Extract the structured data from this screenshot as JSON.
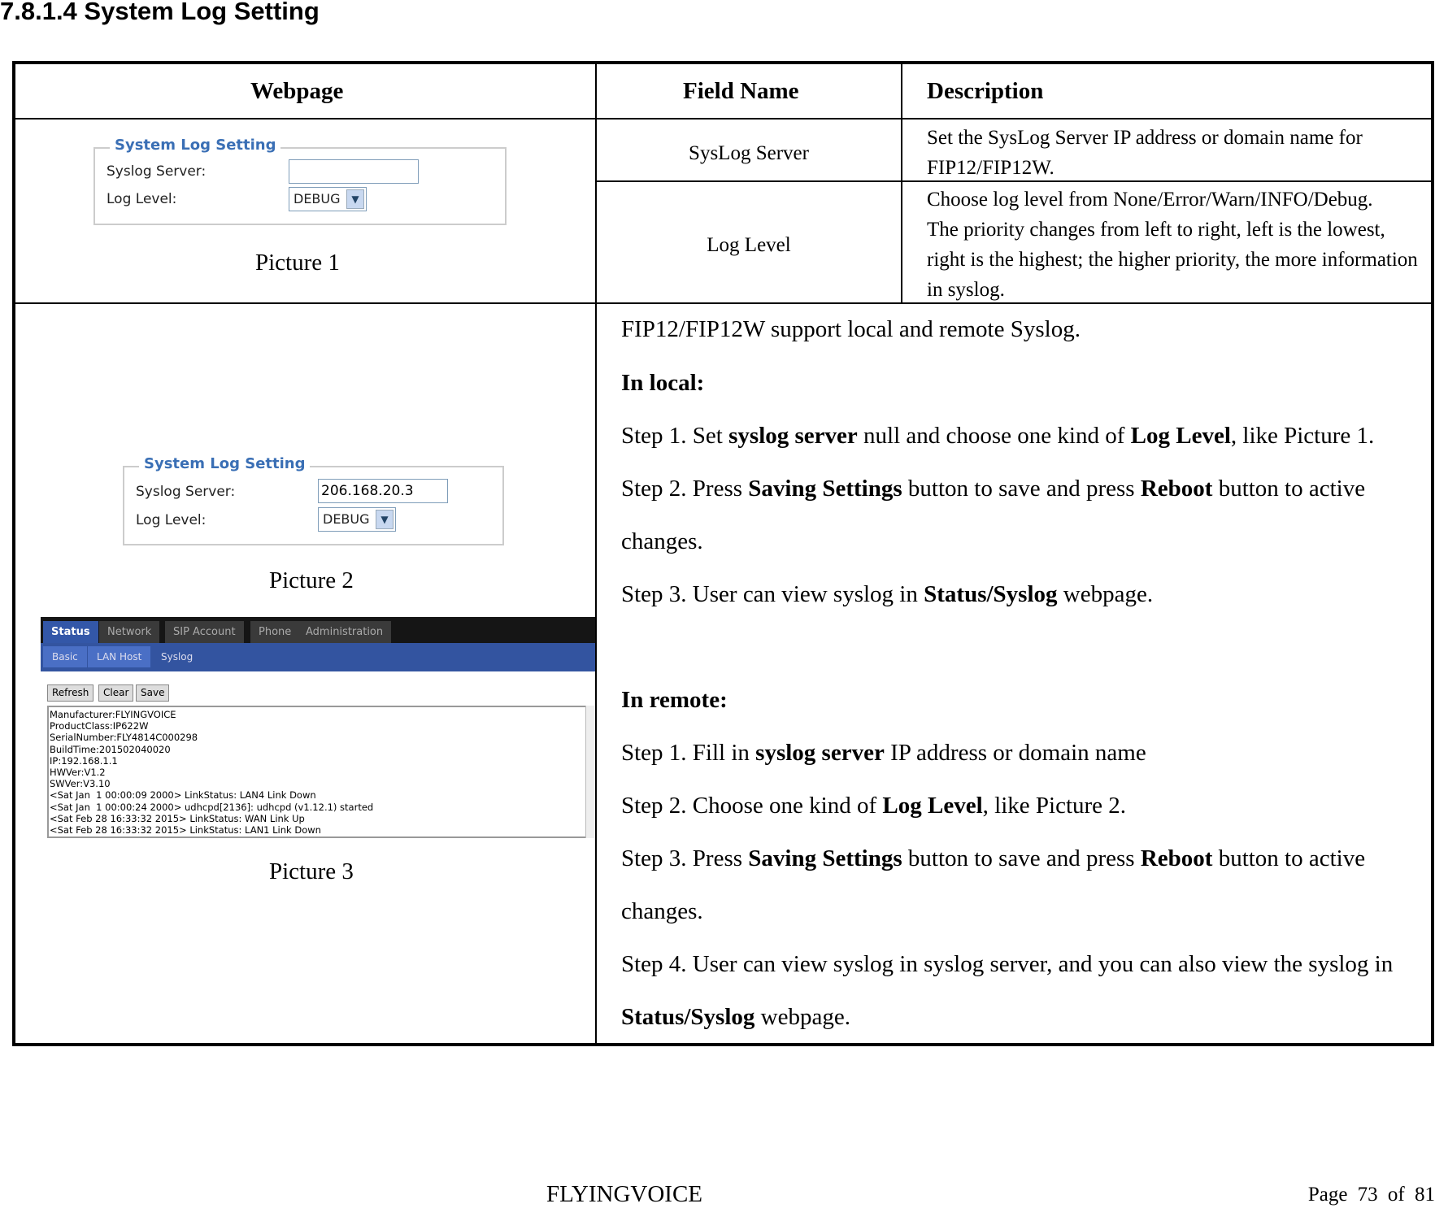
{
  "section_title": "7.8.1.4  System Log Setting",
  "table": {
    "headers": [
      "Webpage",
      "Field Name",
      "Description"
    ],
    "rows": [
      {
        "field": "SysLog Server",
        "description": [
          "Set the SysLog Server IP address or domain name for",
          "FIP12/FIP12W."
        ]
      },
      {
        "field": "Log Level",
        "description": [
          "Choose log level from None/Error/Warn/INFO/Debug.",
          "The priority changes from left to right, left is the lowest,",
          "right is the highest; the higher priority, the more information",
          "in syslog."
        ]
      }
    ]
  },
  "picture1": {
    "legend": "System Log Setting",
    "server_label": "Syslog Server:",
    "server_value": "",
    "level_label": "Log Level:",
    "level_value": "DEBUG",
    "caption": "Picture 1"
  },
  "picture2": {
    "legend": "System Log Setting",
    "server_label": "Syslog Server:",
    "server_value": "206.168.20.3",
    "level_label": "Log Level:",
    "level_value": "DEBUG",
    "caption": "Picture 2"
  },
  "picture3": {
    "tabs": [
      "Status",
      "Network",
      "SIP Account",
      "Phone",
      "Administration"
    ],
    "subtabs": [
      "Basic",
      "LAN Host",
      "Syslog"
    ],
    "buttons": [
      "Refresh",
      "Clear",
      "Save"
    ],
    "log": "Manufacturer:FLYINGVOICE\nProductClass:IP622W\nSerialNumber:FLY4814C000298\nBuildTime:201502040020\nIP:192.168.1.1\nHWVer:V1.2\nSWVer:V3.10\n<Sat Jan  1 00:00:09 2000> LinkStatus: LAN4 Link Down\n<Sat Jan  1 00:00:24 2000> udhcpd[2136]: udhcpd (v1.12.1) started\n<Sat Feb 28 16:33:32 2015> LinkStatus: WAN Link Up\n<Sat Feb 28 16:33:32 2015> LinkStatus: LAN1 Link Down",
    "caption": "Picture 3"
  },
  "description": {
    "intro": "FIP12/FIP12W support local and remote Syslog.",
    "local_heading": "In local:",
    "remote_heading": "In remote:"
  },
  "footer": {
    "brand": "FLYINGVOICE",
    "page": "Page  73  of  81"
  }
}
